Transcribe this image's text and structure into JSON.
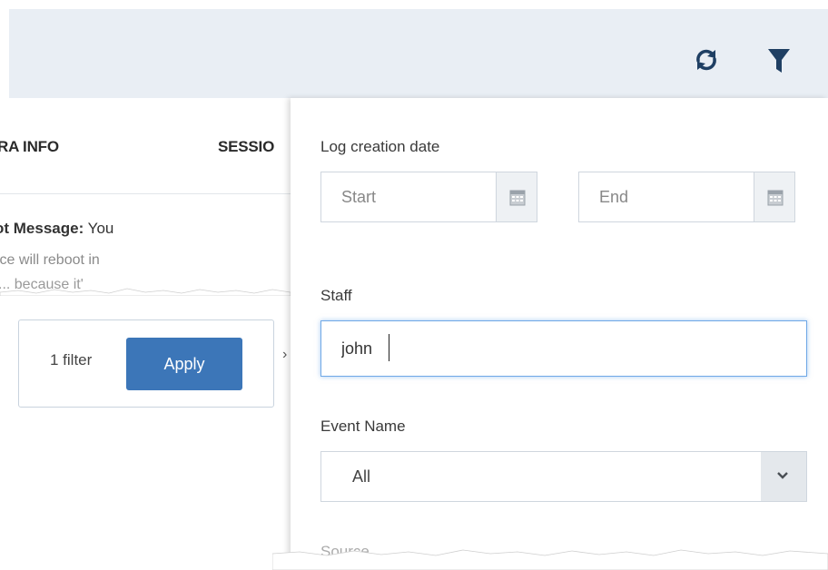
{
  "toolbar": {
    "refresh_icon": "refresh-icon",
    "filter_icon": "filter-icon",
    "accent": "#1f3f63"
  },
  "tabs": {
    "extra_info": "RA INFO",
    "session": "SESSIO"
  },
  "message": {
    "label": "ot Message:",
    "text": " You",
    "line2": "ice will reboot in",
    "line3": "      ...  because it'"
  },
  "filter_summary": {
    "count_text": "1 filter",
    "apply_label": "Apply",
    "button_color": "#3c76b8"
  },
  "side_arrow": "›",
  "filter_panel": {
    "log_creation_date_label": "Log creation date",
    "start_placeholder": "Start",
    "end_placeholder": "End",
    "calendar_icon": "calendar-icon",
    "staff_label": "Staff",
    "staff_value": "john",
    "event_name_label": "Event Name",
    "event_name_value": "All",
    "source_label": "Source"
  }
}
